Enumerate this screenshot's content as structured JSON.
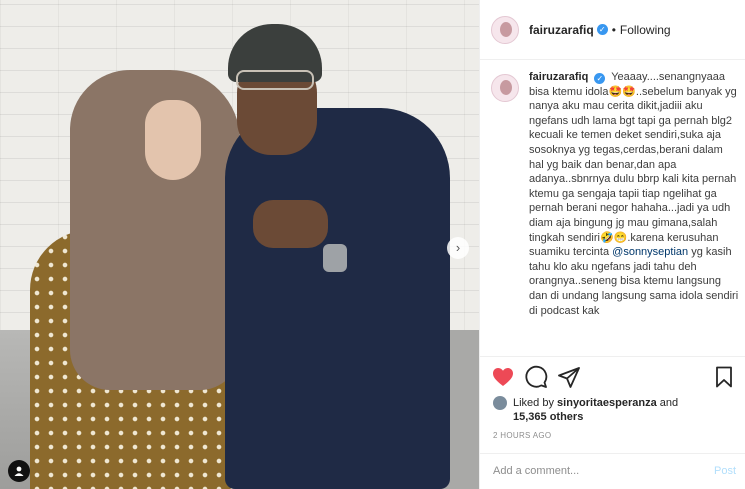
{
  "post": {
    "username": "fairuzarafiq",
    "follow_status": "Following",
    "separator": "•"
  },
  "caption": {
    "username": "fairuzarafiq",
    "text_part1": "Yeaaay....senangnyaaa bisa ktemu idola",
    "emoji1": "🤩🤩",
    "text_part2": "..sebelum banyak yg nanya aku mau cerita dikit,jadiii aku ngefans udh lama bgt tapi ga pernah blg2 kecuali ke temen deket sendiri,suka aja sosoknya yg tegas,cerdas,berani dalam hal yg baik dan benar,dan apa adanya..sbnrnya dulu bbrp kali kita pernah ktemu ga sengaja tapii tiap ngelihat ga pernah berani negor hahaha...jadi ya udh diam aja bingung jg mau gimana,salah tingkah sendiri",
    "emoji2": "🤣😁",
    "text_part3": ".karena kerusuhan suamiku tercinta",
    "mention": "@sonnyseptian",
    "text_part4": "yg kasih tahu klo aku ngefans jadi tahu deh orangnya..seneng bisa ktemu langsung dan di undang langsung sama idola sendiri di podcast kak"
  },
  "likes": {
    "liked_by_prefix": "Liked by",
    "liked_by_user": "sinyoritaesperanza",
    "and": "and",
    "others": "15,365 others"
  },
  "timestamp": "2 HOURS AGO",
  "comment_box": {
    "placeholder": "Add a comment...",
    "post_label": "Post"
  },
  "icons": {
    "like": "heart-icon",
    "comment": "comment-icon",
    "share": "share-icon",
    "save": "bookmark-icon",
    "next": "chevron-right-icon",
    "tag": "person-tag-icon"
  },
  "colors": {
    "like_red": "#ed4956",
    "verified_blue": "#3897f0",
    "post_disabled": "#b2dffc",
    "mention": "#00376b"
  }
}
